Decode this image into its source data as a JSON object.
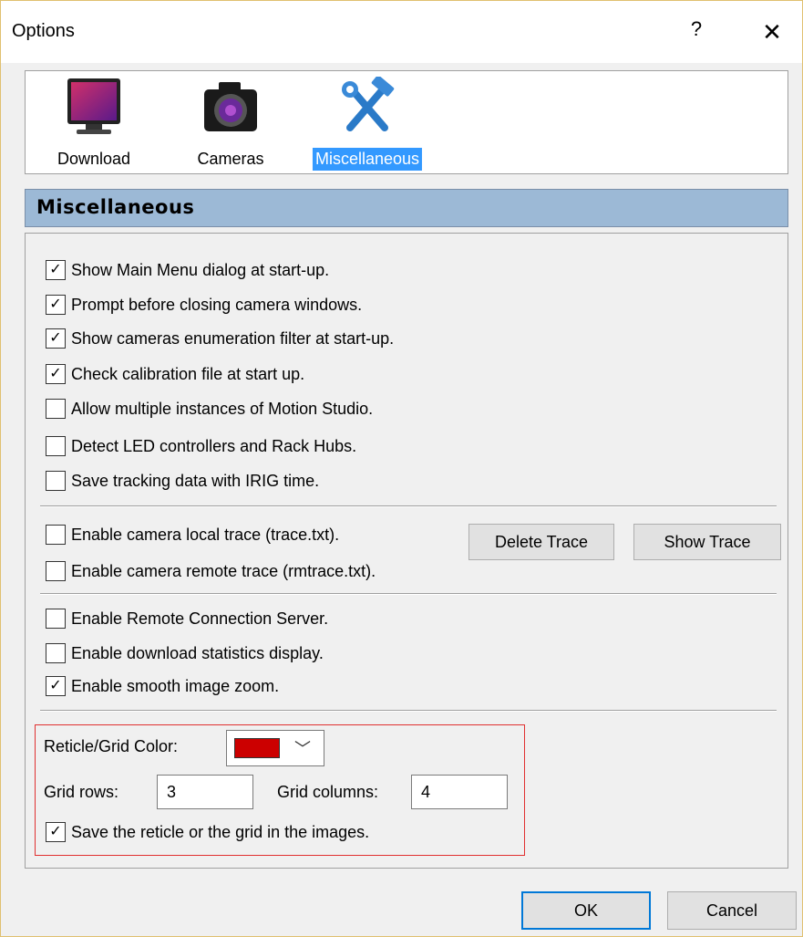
{
  "window": {
    "title": "Options",
    "help_label": "?",
    "close_label": "✕"
  },
  "toolbar": {
    "items": [
      {
        "label": "Download",
        "icon": "monitor-icon"
      },
      {
        "label": "Cameras",
        "icon": "camera-icon"
      },
      {
        "label": "Miscellaneous",
        "icon": "tools-icon",
        "selected": true
      }
    ]
  },
  "section": {
    "title": "Miscellaneous"
  },
  "general_options": [
    {
      "label": "Show Main Menu dialog at start-up.",
      "checked": true
    },
    {
      "label": "Prompt before closing camera windows.",
      "checked": true
    },
    {
      "label": "Show cameras enumeration filter at start-up.",
      "checked": true
    },
    {
      "label": "Check calibration file at start up.",
      "checked": true
    },
    {
      "label": "Allow multiple instances of Motion Studio.",
      "checked": false
    },
    {
      "label": "Detect LED controllers and Rack Hubs.",
      "checked": false
    },
    {
      "label": "Save tracking data with IRIG time.",
      "checked": false
    }
  ],
  "trace_options": [
    {
      "label": "Enable camera local trace (trace.txt).",
      "checked": false
    },
    {
      "label": "Enable camera remote trace (rmtrace.txt).",
      "checked": false
    }
  ],
  "trace_buttons": {
    "delete": "Delete Trace",
    "show": "Show Trace"
  },
  "server_options": [
    {
      "label": "Enable Remote Connection Server.",
      "checked": false
    },
    {
      "label": "Enable download statistics display.",
      "checked": false
    },
    {
      "label": "Enable smooth image zoom.",
      "checked": true
    }
  ],
  "reticle": {
    "color_label": "Reticle/Grid Color:",
    "color_value": "#cc0000",
    "rows_label": "Grid rows:",
    "rows_value": "3",
    "columns_label": "Grid columns:",
    "columns_value": "4",
    "save_label": "Save the reticle or the grid in the images.",
    "save_checked": true
  },
  "footer": {
    "ok": "OK",
    "cancel": "Cancel"
  },
  "colors": {
    "accent": "#0078d7",
    "selection": "#3399ff",
    "header": "#9cb9d6",
    "highlight": "#e03030"
  }
}
